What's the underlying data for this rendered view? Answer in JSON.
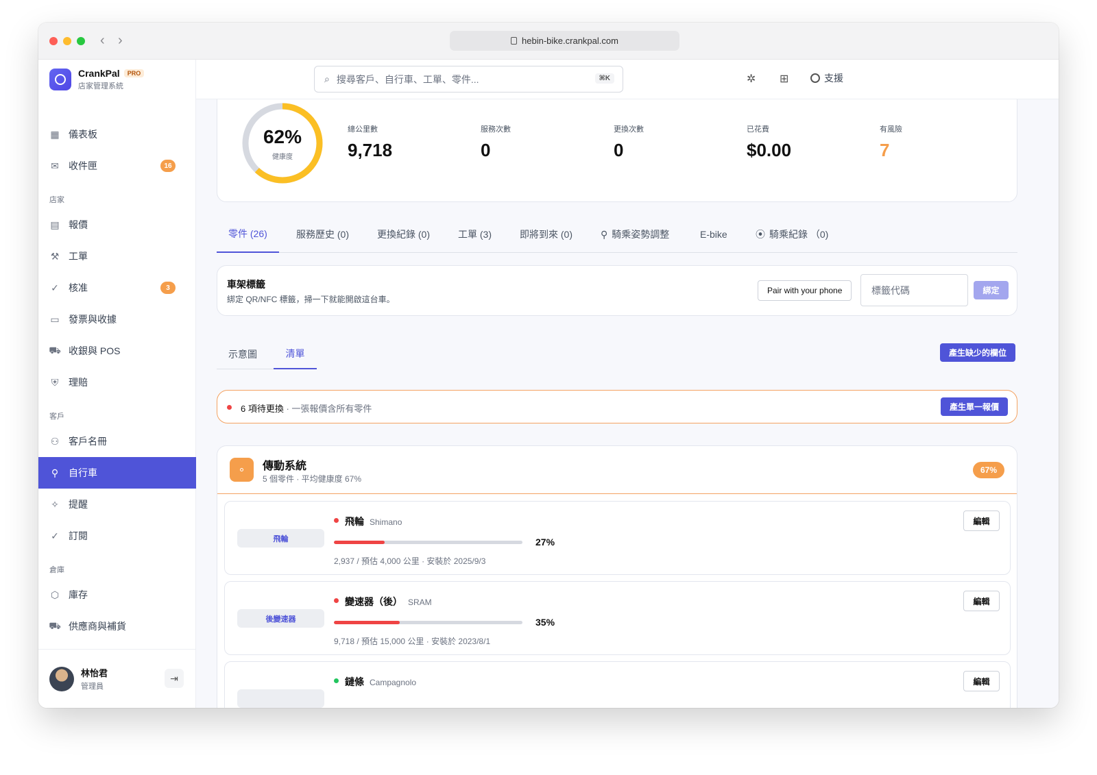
{
  "browser": {
    "url": "hebin-bike.crankpal.com"
  },
  "brand": {
    "name": "CrankPal",
    "badge": "PRO",
    "subtitle": "店家管理系統"
  },
  "sidebar": {
    "items_top": [
      {
        "label": "儀表板",
        "icon": "grid-icon"
      },
      {
        "label": "收件匣",
        "icon": "inbox-icon",
        "badge": "16"
      }
    ],
    "section_store": "店家",
    "items_store": [
      {
        "label": "報價",
        "icon": "document-icon"
      },
      {
        "label": "工單",
        "icon": "wrench-icon"
      },
      {
        "label": "核准",
        "icon": "check-circle-icon",
        "badge": "3"
      },
      {
        "label": "發票與收據",
        "icon": "banknote-icon"
      },
      {
        "label": "收銀與 POS",
        "icon": "cart-icon"
      },
      {
        "label": "理賠",
        "icon": "shield-icon"
      }
    ],
    "section_customers": "客戶",
    "items_customers": [
      {
        "label": "客戶名冊",
        "icon": "users-icon"
      },
      {
        "label": "自行車",
        "icon": "bike-icon",
        "active": true
      },
      {
        "label": "提醒",
        "icon": "sparkle-icon"
      },
      {
        "label": "訂閱",
        "icon": "check-circle-icon"
      }
    ],
    "section_warehouse": "倉庫",
    "items_warehouse": [
      {
        "label": "庫存",
        "icon": "box-icon"
      },
      {
        "label": "供應商與補貨",
        "icon": "truck-icon"
      }
    ],
    "user": {
      "name": "林怡君",
      "role": "管理員"
    }
  },
  "topbar": {
    "search_placeholder": "搜尋客戶、自行車、工單、零件...",
    "shortcut": "⌘K",
    "support_label": "支援"
  },
  "stats": {
    "health": {
      "value": "62%",
      "label": "健康度",
      "fraction": 0.62
    },
    "items": [
      {
        "label": "總公里數",
        "value": "9,718"
      },
      {
        "label": "服務次數",
        "value": "0"
      },
      {
        "label": "更換次數",
        "value": "0"
      },
      {
        "label": "已花費",
        "value": "$0.00"
      },
      {
        "label": "有風險",
        "value": "7",
        "warn": true
      }
    ]
  },
  "tabs": [
    {
      "label": "零件 (26)",
      "active": true
    },
    {
      "label": "服務歷史 (0)"
    },
    {
      "label": "更換紀錄 (0)"
    },
    {
      "label": "工單 (3)"
    },
    {
      "label": "即將到來 (0)"
    },
    {
      "label": "騎乘姿勢調整",
      "icon": "bike-icon"
    },
    {
      "label": "E-bike"
    },
    {
      "label": "騎乘紀錄 （0)",
      "icon": "pin-icon"
    }
  ],
  "frame_tag": {
    "title": "車架標籤",
    "description": "綁定 QR/NFC 標籤，掃一下就能開啟這台車。",
    "pair_button": "Pair with your phone",
    "input_placeholder": "標籤代碼",
    "bind_button": "綁定"
  },
  "subtabs": [
    {
      "label": "示意圖"
    },
    {
      "label": "清單",
      "active": true
    }
  ],
  "generate_missing_button": "產生缺少的欄位",
  "alert": {
    "count_text": "6 項待更換",
    "detail_text": " · 一張報價含所有零件",
    "button": "產生單一報價"
  },
  "group": {
    "title": "傳動系統",
    "subtitle": "5 個零件 · 平均健康度 67%",
    "percent": "67%",
    "parts": [
      {
        "chip": "飛輪",
        "name": "飛輪",
        "brand": "Shimano",
        "status": "red",
        "fraction": 0.27,
        "percent": "27%",
        "meta": "2,937 / 預估 4,000 公里 · 安裝於 2025/9/3",
        "edit": "編輯"
      },
      {
        "chip": "後變速器",
        "name": "變速器（後）",
        "brand": "SRAM",
        "status": "red",
        "fraction": 0.35,
        "percent": "35%",
        "meta": "9,718 / 預估 15,000 公里 · 安裝於 2023/8/1",
        "edit": "編輯"
      },
      {
        "chip": "",
        "name": "鏈條",
        "brand": "Campagnolo",
        "status": "green",
        "edit": "編輯"
      }
    ]
  },
  "colors": {
    "accent": "#4f54d8",
    "warn": "#f59e4b",
    "danger": "#ef4444",
    "ok": "#22c55e"
  }
}
